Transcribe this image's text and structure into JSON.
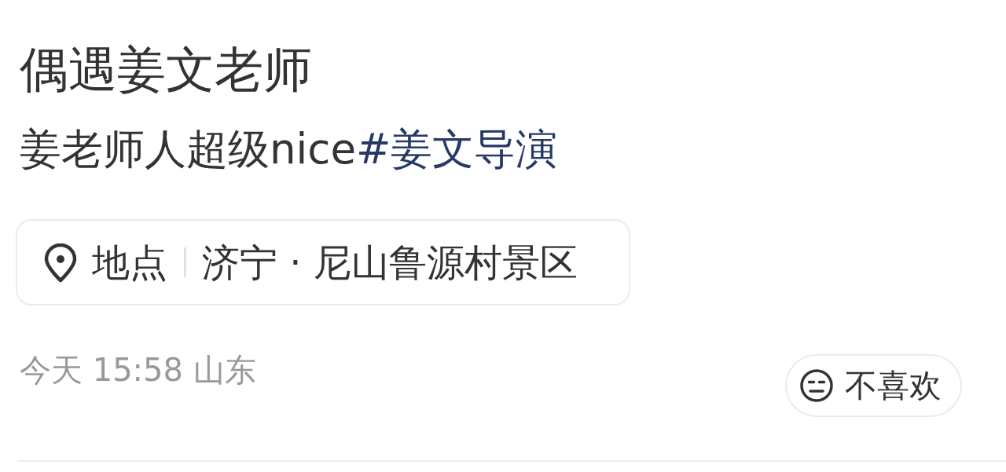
{
  "post": {
    "title": "偶遇姜文老师",
    "body": "姜老师人超级nice",
    "hashtag": "#姜文导演"
  },
  "location": {
    "label": "地点",
    "place": "济宁 · 尼山鲁源村景区"
  },
  "meta": {
    "time": "今天 15:58 山东"
  },
  "dislike_button": {
    "label": "不喜欢"
  }
}
